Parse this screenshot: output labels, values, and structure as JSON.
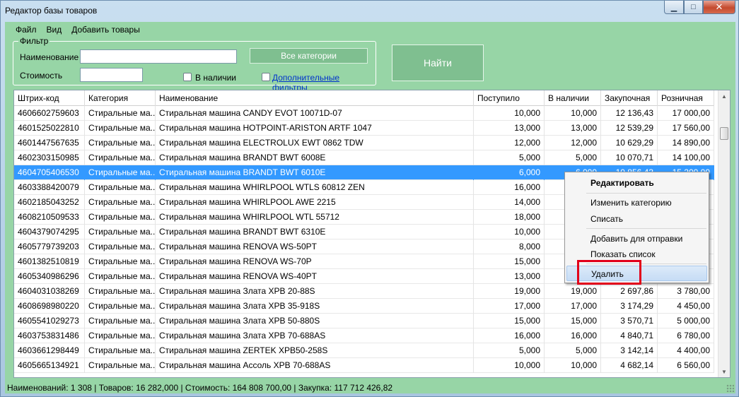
{
  "window": {
    "title": "Редактор базы товаров",
    "minimize_glyph": "▁",
    "maximize_glyph": "□",
    "close_glyph": "✕"
  },
  "menu": [
    "Файл",
    "Вид",
    "Добавить товары"
  ],
  "filter": {
    "legend": "Фильтр",
    "name_label": "Наименование",
    "name_value": "",
    "price_label": "Стоимость",
    "price_value": "",
    "category_button": "Все категории",
    "in_stock_label": "В наличии",
    "in_stock_checked": false,
    "extra_filters_label": "Дополнительные фильтры",
    "extra_filters_checked": false
  },
  "find_button": "Найти",
  "table": {
    "columns": [
      "Штрих-код",
      "Категория",
      "Наименование",
      "Поступило",
      "В наличии",
      "Закупочная",
      "Розничная"
    ],
    "selected_row": 4,
    "rows": [
      [
        "4606602759603",
        "Стиральные ма...",
        "Стиральная машина CANDY EVOT 10071D-07",
        "10,000",
        "10,000",
        "12 136,43",
        "17 000,00"
      ],
      [
        "4601525022810",
        "Стиральные ма...",
        "Стиральная машина HOTPOINT-ARISTON ARTF 1047",
        "13,000",
        "13,000",
        "12 539,29",
        "17 560,00"
      ],
      [
        "4601447567635",
        "Стиральные ма...",
        "Стиральная машина ELECTROLUX EWT 0862 TDW",
        "12,000",
        "12,000",
        "10 629,29",
        "14 890,00"
      ],
      [
        "4602303150985",
        "Стиральные ма...",
        "Стиральная машина BRANDT BWT 6008E",
        "5,000",
        "5,000",
        "10 070,71",
        "14 100,00"
      ],
      [
        "4604705406530",
        "Стиральные ма...",
        "Стиральная машина BRANDT BWT 6010E",
        "6,000",
        "6,000",
        "10 856,43",
        "15 200,00"
      ],
      [
        "4603388420079",
        "Стиральные ма...",
        "Стиральная машина WHIRLPOOL WTLS 60812 ZEN",
        "16,000",
        "",
        "",
        ""
      ],
      [
        "4602185043252",
        "Стиральные ма...",
        "Стиральная машина WHIRLPOOL AWE 2215",
        "14,000",
        "",
        "",
        ""
      ],
      [
        "4608210509533",
        "Стиральные ма...",
        "Стиральная машина WHIRLPOOL WTL 55712",
        "18,000",
        "",
        "",
        ""
      ],
      [
        "4604379074295",
        "Стиральные ма...",
        "Стиральная машина BRANDT BWT 6310E",
        "10,000",
        "",
        "",
        ""
      ],
      [
        "4605779739203",
        "Стиральные ма...",
        "Стиральная машина RENOVA WS-50PT",
        "8,000",
        "",
        "",
        ""
      ],
      [
        "4601382510819",
        "Стиральные ма...",
        "Стиральная машина RENOVA WS-70P",
        "15,000",
        "",
        "",
        ""
      ],
      [
        "4605340986296",
        "Стиральные ма...",
        "Стиральная машина RENOVA WS-40PT",
        "13,000",
        "",
        "",
        ""
      ],
      [
        "4604031038269",
        "Стиральные ма...",
        "Стиральная машина Злата XPB 20-88S",
        "19,000",
        "19,000",
        "2 697,86",
        "3 780,00"
      ],
      [
        "4608698980220",
        "Стиральные ма...",
        "Стиральная машина Злата XPB 35-918S",
        "17,000",
        "17,000",
        "3 174,29",
        "4 450,00"
      ],
      [
        "4605541029273",
        "Стиральные ма...",
        "Стиральная машина Злата XPB 50-880S",
        "15,000",
        "15,000",
        "3 570,71",
        "5 000,00"
      ],
      [
        "4603753831486",
        "Стиральные ма...",
        "Стиральная машина Злата XPB 70-688AS",
        "16,000",
        "16,000",
        "4 840,71",
        "6 780,00"
      ],
      [
        "4603661298449",
        "Стиральные ма...",
        "Стиральная машина ZERTEK XPB50-258S",
        "5,000",
        "5,000",
        "3 142,14",
        "4 400,00"
      ],
      [
        "4605665134921",
        "Стиральные ма...",
        "Стиральная машина Ассоль XPB 70-688AS",
        "10,000",
        "10,000",
        "4 682,14",
        "6 560,00"
      ]
    ]
  },
  "context_menu": {
    "items": [
      "Редактировать",
      "Изменить категорию",
      "Списать",
      "Добавить для отправки",
      "Показать список",
      "Удалить"
    ],
    "highlighted_item": "Удалить"
  },
  "status": {
    "text": "Наименований:   1 308   | Товаров:   16 282,000   | Стоимость:   164 808 700,00   | Закупка:   117 712 426,82"
  },
  "colors": {
    "client_bg": "#97d5a6",
    "selection": "#3399ff",
    "highlight_border": "#e2001a"
  }
}
